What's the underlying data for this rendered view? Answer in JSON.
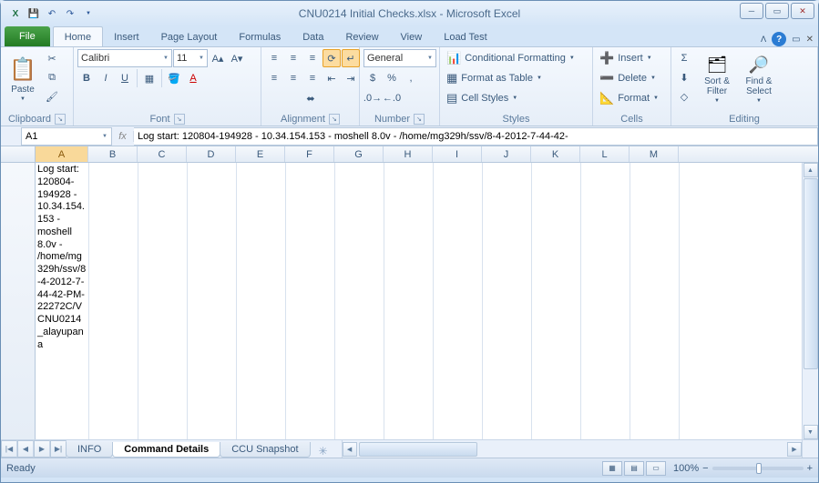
{
  "window": {
    "title": "CNU0214 Initial Checks.xlsx - Microsoft Excel"
  },
  "qat": {
    "save": "💾",
    "undo": "↶",
    "redo": "↷"
  },
  "tabs": {
    "file": "File",
    "home": "Home",
    "insert": "Insert",
    "pagelayout": "Page Layout",
    "formulas": "Formulas",
    "data": "Data",
    "review": "Review",
    "view": "View",
    "loadtest": "Load Test"
  },
  "ribbon": {
    "clipboard": {
      "paste": "Paste",
      "label": "Clipboard"
    },
    "font": {
      "label": "Font",
      "name": "Calibri",
      "size": "11",
      "bold": "B",
      "italic": "I",
      "underline": "U"
    },
    "alignment": {
      "label": "Alignment"
    },
    "number": {
      "label": "Number",
      "format": "General"
    },
    "styles": {
      "label": "Styles",
      "condfmt": "Conditional Formatting",
      "table": "Format as Table",
      "cellstyles": "Cell Styles"
    },
    "cells": {
      "label": "Cells",
      "insert": "Insert",
      "delete": "Delete",
      "format": "Format"
    },
    "editing": {
      "label": "Editing",
      "sortfilter": "Sort & Filter",
      "findselect": "Find & Select"
    }
  },
  "namebox": "A1",
  "formula": "Log start: 120804-194928 - 10.34.154.153 - moshell 8.0v - /home/mg329h/ssv/8-4-2012-7-44-42-",
  "columns": [
    "A",
    "B",
    "C",
    "D",
    "E",
    "F",
    "G",
    "H",
    "I",
    "J",
    "K",
    "L",
    "M"
  ],
  "cellA1": "Log start: 120804-194928 - 10.34.154.153 - moshell 8.0v - /home/mg329h/ssv/8-4-2012-7-44-42-PM-22272C/VCNU0214_alayupana",
  "sheets": {
    "info": "INFO",
    "cmd": "Command Details",
    "ccu": "CCU Snapshot"
  },
  "status": {
    "ready": "Ready",
    "zoom": "100%"
  }
}
